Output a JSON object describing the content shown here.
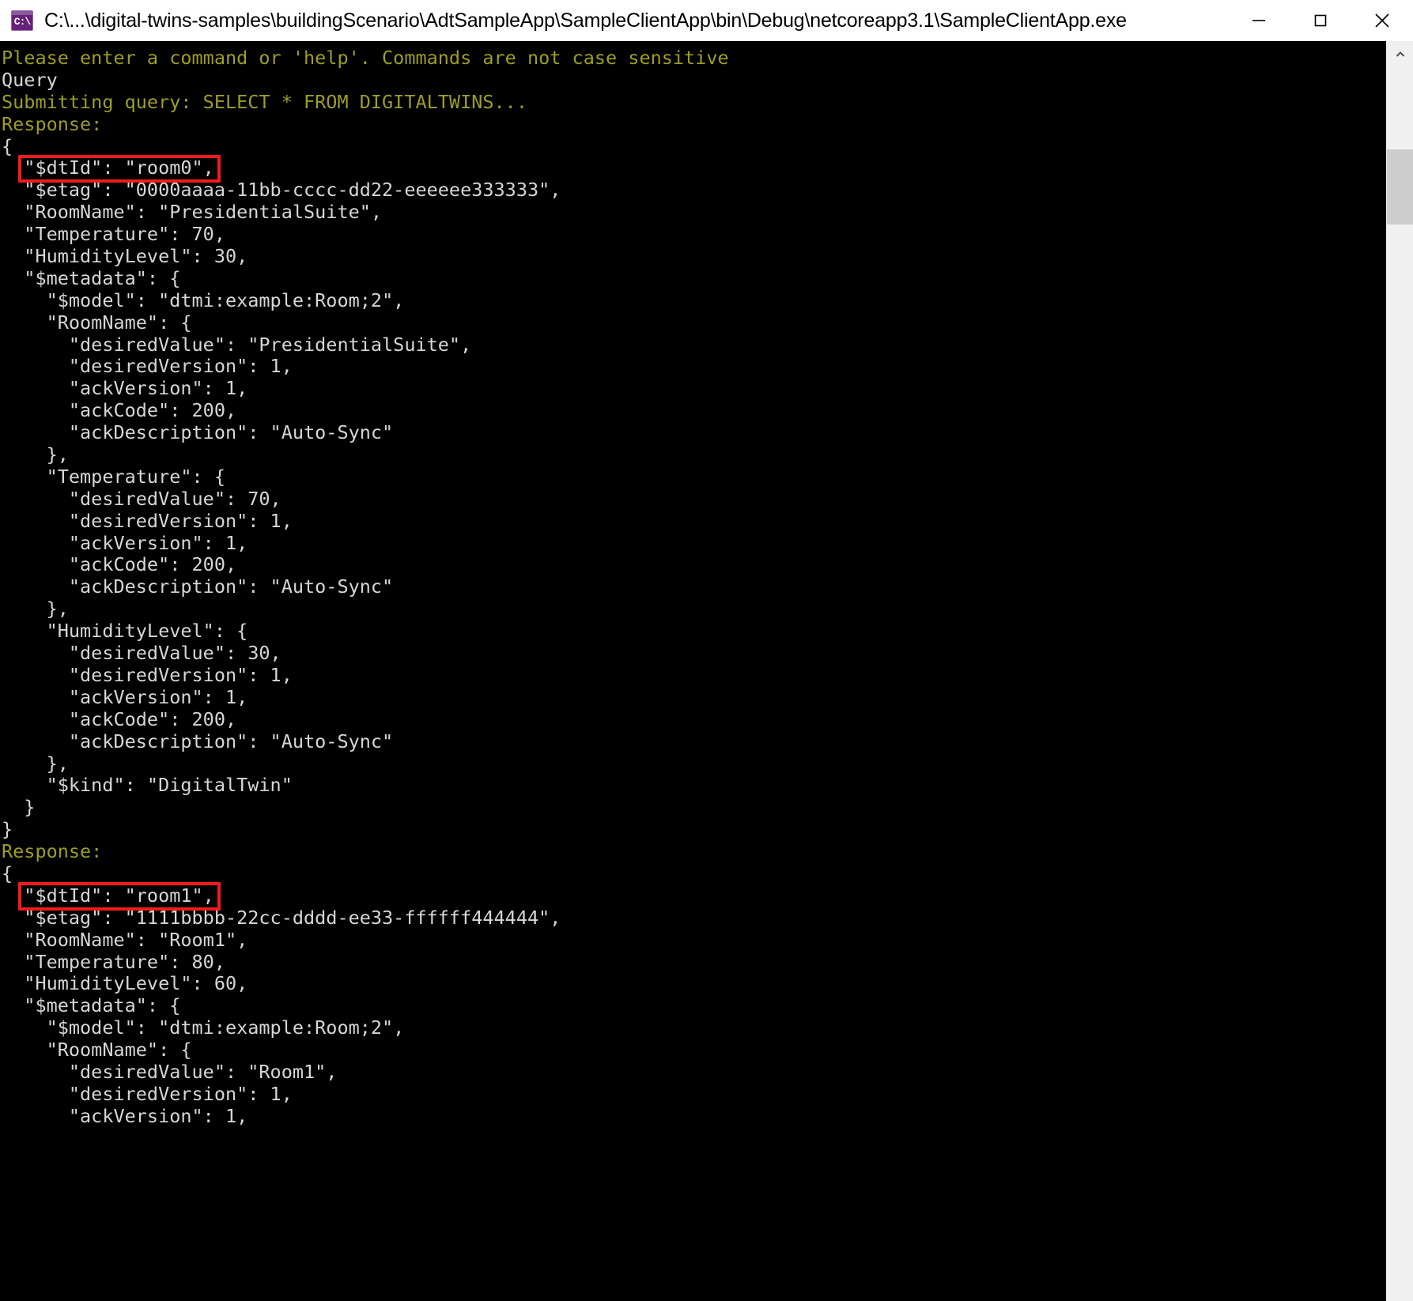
{
  "window": {
    "title": "C:\\...\\digital-twins-samples\\buildingScenario\\AdtSampleApp\\SampleClientApp\\bin\\Debug\\netcoreapp3.1\\SampleClientApp.exe",
    "icon": "console-app-icon",
    "icon_glyph": "C:\\",
    "controls": {
      "minimize": "minimize-button",
      "maximize": "maximize-button",
      "close": "close-button"
    }
  },
  "colors": {
    "background": "#000000",
    "text": "#d6d6d6",
    "prompt_yellow": "#9d9d24",
    "highlight_red": "#f21b1b",
    "titlebar": "#ffffff",
    "scrollbar_track": "#f0f0f0",
    "scrollbar_thumb": "#cdcdcd"
  },
  "scrollbar": {
    "up_arrow": "chevron-up-icon",
    "thumb_position_percent": 7
  },
  "console": {
    "lines": [
      {
        "text": "Please enter a command or 'help'. Commands are not case sensitive",
        "color": "yellow"
      },
      {
        "text": "Query",
        "color": "white"
      },
      {
        "text": "Submitting query: SELECT * FROM DIGITALTWINS...",
        "color": "yellow"
      },
      {
        "text": "Response:",
        "color": "yellow"
      },
      {
        "text": "{",
        "color": "white"
      },
      {
        "text": "  \"$dtId\": \"room0\",",
        "color": "white",
        "highlight": true
      },
      {
        "text": "  \"$etag\": \"0000aaaa-11bb-cccc-dd22-eeeeee333333\",",
        "color": "white"
      },
      {
        "text": "  \"RoomName\": \"PresidentialSuite\",",
        "color": "white"
      },
      {
        "text": "  \"Temperature\": 70,",
        "color": "white"
      },
      {
        "text": "  \"HumidityLevel\": 30,",
        "color": "white"
      },
      {
        "text": "  \"$metadata\": {",
        "color": "white"
      },
      {
        "text": "    \"$model\": \"dtmi:example:Room;2\",",
        "color": "white"
      },
      {
        "text": "    \"RoomName\": {",
        "color": "white"
      },
      {
        "text": "      \"desiredValue\": \"PresidentialSuite\",",
        "color": "white"
      },
      {
        "text": "      \"desiredVersion\": 1,",
        "color": "white"
      },
      {
        "text": "      \"ackVersion\": 1,",
        "color": "white"
      },
      {
        "text": "      \"ackCode\": 200,",
        "color": "white"
      },
      {
        "text": "      \"ackDescription\": \"Auto-Sync\"",
        "color": "white"
      },
      {
        "text": "    },",
        "color": "white"
      },
      {
        "text": "    \"Temperature\": {",
        "color": "white"
      },
      {
        "text": "      \"desiredValue\": 70,",
        "color": "white"
      },
      {
        "text": "      \"desiredVersion\": 1,",
        "color": "white"
      },
      {
        "text": "      \"ackVersion\": 1,",
        "color": "white"
      },
      {
        "text": "      \"ackCode\": 200,",
        "color": "white"
      },
      {
        "text": "      \"ackDescription\": \"Auto-Sync\"",
        "color": "white"
      },
      {
        "text": "    },",
        "color": "white"
      },
      {
        "text": "    \"HumidityLevel\": {",
        "color": "white"
      },
      {
        "text": "      \"desiredValue\": 30,",
        "color": "white"
      },
      {
        "text": "      \"desiredVersion\": 1,",
        "color": "white"
      },
      {
        "text": "      \"ackVersion\": 1,",
        "color": "white"
      },
      {
        "text": "      \"ackCode\": 200,",
        "color": "white"
      },
      {
        "text": "      \"ackDescription\": \"Auto-Sync\"",
        "color": "white"
      },
      {
        "text": "    },",
        "color": "white"
      },
      {
        "text": "    \"$kind\": \"DigitalTwin\"",
        "color": "white"
      },
      {
        "text": "  }",
        "color": "white"
      },
      {
        "text": "}",
        "color": "white"
      },
      {
        "text": "Response:",
        "color": "yellow"
      },
      {
        "text": "{",
        "color": "white"
      },
      {
        "text": "  \"$dtId\": \"room1\",",
        "color": "white",
        "highlight": true
      },
      {
        "text": "  \"$etag\": \"1111bbbb-22cc-dddd-ee33-ffffff444444\",",
        "color": "white"
      },
      {
        "text": "  \"RoomName\": \"Room1\",",
        "color": "white"
      },
      {
        "text": "  \"Temperature\": 80,",
        "color": "white"
      },
      {
        "text": "  \"HumidityLevel\": 60,",
        "color": "white"
      },
      {
        "text": "  \"$metadata\": {",
        "color": "white"
      },
      {
        "text": "    \"$model\": \"dtmi:example:Room;2\",",
        "color": "white"
      },
      {
        "text": "    \"RoomName\": {",
        "color": "white"
      },
      {
        "text": "      \"desiredValue\": \"Room1\",",
        "color": "white"
      },
      {
        "text": "      \"desiredVersion\": 1,",
        "color": "white"
      },
      {
        "text": "      \"ackVersion\": 1,",
        "color": "white"
      }
    ]
  }
}
